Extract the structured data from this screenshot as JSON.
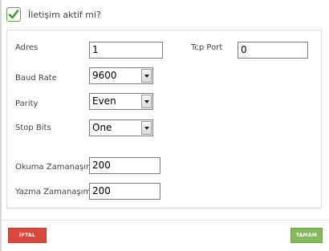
{
  "header": {
    "checkbox_checked": true,
    "checkbox_label": "İletişim aktif mi?",
    "check_color": "#3f9a2f"
  },
  "form": {
    "address": {
      "label": "Adres",
      "value": "1"
    },
    "baud_rate": {
      "label": "Baud Rate",
      "value": "9600"
    },
    "parity": {
      "label": "Parity",
      "value": "Even"
    },
    "stop_bits": {
      "label": "Stop Bits",
      "value": "One"
    },
    "tcp_port": {
      "label": "Tcp Port",
      "value": "0"
    },
    "read_timeout": {
      "label": "Okuma Zamanaşımı",
      "value": "200"
    },
    "write_timeout": {
      "label": "Yazma Zamanaşımı",
      "value": "200"
    }
  },
  "footer": {
    "cancel_label": "İPTAL",
    "cancel_color": "#d9473e",
    "ok_label": "TAMAM",
    "ok_color": "#86b95d"
  },
  "icons": {
    "checkmark": "checkmark-icon",
    "dropdown": "chevron-down-icon"
  }
}
